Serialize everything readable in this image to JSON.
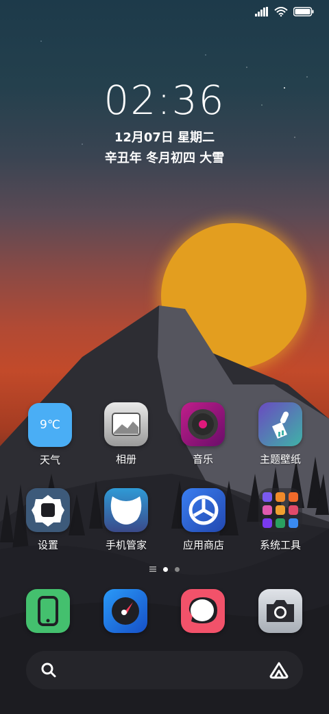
{
  "status_bar": {
    "signal_icon": "signal-bars-icon",
    "wifi_icon": "wifi-icon",
    "battery_icon": "battery-icon",
    "battery_level": 1.0
  },
  "lockscreen": {
    "time": "02:36",
    "date": "12月07日 星期二",
    "lunar": "辛丑年 冬月初四 大雪"
  },
  "apps": [
    {
      "label": "天气",
      "icon": "weather-icon",
      "badge_text": "9℃"
    },
    {
      "label": "相册",
      "icon": "gallery-icon"
    },
    {
      "label": "音乐",
      "icon": "music-icon"
    },
    {
      "label": "主题壁纸",
      "icon": "themes-brush-icon"
    },
    {
      "label": "设置",
      "icon": "settings-icon"
    },
    {
      "label": "手机管家",
      "icon": "security-icon"
    },
    {
      "label": "应用商店",
      "icon": "app-store-icon"
    },
    {
      "label": "系统工具",
      "icon": "system-tools-folder-icon"
    }
  ],
  "page_indicator": {
    "pages": 2,
    "current": 1
  },
  "dock": [
    {
      "name": "phone",
      "icon": "phone-icon"
    },
    {
      "name": "browser",
      "icon": "browser-icon"
    },
    {
      "name": "messages",
      "icon": "messages-icon"
    },
    {
      "name": "camera",
      "icon": "camera-icon"
    }
  ],
  "search_bar": {
    "search_icon": "search-icon",
    "assistant_icon": "assistant-icon"
  },
  "colors": {
    "sun": "#e39e1f",
    "weather_bg": "#4aaef5",
    "gallery_bg": "#d6d6d6",
    "music_bg": "#a0188c",
    "themes_bg": "#3aa8a0",
    "settings_bg": "#3d5a7a",
    "security_bg": "#2f6aa6",
    "appstore_bg": "#2e6fd6",
    "phone_bg": "#44c06e",
    "browser_bg": "#1e7be8",
    "messages_bg": "#f2526a",
    "camera_bg": "#c9ced6"
  }
}
